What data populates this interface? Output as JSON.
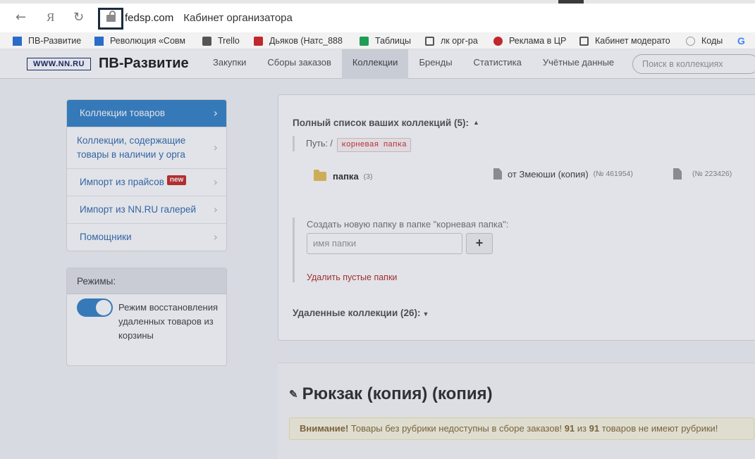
{
  "browser": {
    "back_glyph": "←",
    "yandex_glyph": "Я",
    "reload_glyph": "↻",
    "domain": "fedsp.com",
    "page_title": "Кабинет организатора"
  },
  "bookmarks": [
    {
      "label": "ПВ-Развитие",
      "icon": "pv-icon",
      "color": "#2a6cc7"
    },
    {
      "label": "Революция «Совм",
      "icon": "pv-icon",
      "color": "#2a6cc7"
    },
    {
      "label": "Trello",
      "icon": "trello-icon",
      "color": "#555"
    },
    {
      "label": "Дьяков (Натс_888",
      "icon": "d-icon",
      "color": "#c0282d"
    },
    {
      "label": "Таблицы",
      "icon": "sheets-icon",
      "color": "#1f9d55"
    },
    {
      "label": "лк орг-ра",
      "icon": "cart-icon",
      "color": "#555"
    },
    {
      "label": "Реклама в ЦР",
      "icon": "star-icon",
      "color": "#c0282d"
    },
    {
      "label": "Кабинет модерато",
      "icon": "cart-icon",
      "color": "#555"
    },
    {
      "label": "Коды",
      "icon": "codes-icon",
      "color": "#999"
    },
    {
      "label": "G",
      "icon": "google-icon",
      "color": "#4285f4"
    }
  ],
  "header": {
    "logo_text": "WWW.NN.RU",
    "brand": "ПВ-Развитие",
    "nav": [
      "Закупки",
      "Сборы заказов",
      "Коллекции",
      "Бренды",
      "Статистика",
      "Учётные данные"
    ],
    "active_nav": "Коллекции",
    "search_placeholder": "Поиск в коллекциях"
  },
  "sidebar": {
    "items": [
      {
        "label": "Коллекции товаров"
      },
      {
        "label": "Коллекции, содержащие товары в наличии у орга"
      },
      {
        "label": "Импорт из прайсов",
        "badge": "new"
      },
      {
        "label": "Импорт из NN.RU галерей"
      },
      {
        "label": "Помощники"
      }
    ],
    "chevron": "›"
  },
  "modes": {
    "title": "Режимы:",
    "toggle_label": "Режим восстановления удаленных товаров из корзины",
    "toggle_on": true
  },
  "collections": {
    "title": "Полный список ваших коллекций (5):",
    "caret_up": "▲",
    "path_label": "Путь: /",
    "path_tag": "корневая папка",
    "folder_name": "папка",
    "folder_count": "(3)",
    "doc1_name": "от Змеюши (копия)",
    "doc1_num": "(№ 461954)",
    "doc2_num": "(№ 223426)",
    "new_folder_label": "Создать новую папку в папке \"корневая папка\":",
    "new_folder_placeholder": "имя папки",
    "plus": "+",
    "delete_empty": "Удалить пустые папки",
    "deleted_title": "Удаленные коллекции (26):",
    "caret_down": "▼"
  },
  "collection_view": {
    "pencil": "✎",
    "title": "Рюкзак (копия) (копия)",
    "warning_strong": "Внимание!",
    "warning_text_1": " Товары без рубрики недоступны в сборе заказов! ",
    "warning_n1": "91",
    "warning_text_2": " из ",
    "warning_n2": "91",
    "warning_text_3": " товаров не имеют рубрики!"
  }
}
